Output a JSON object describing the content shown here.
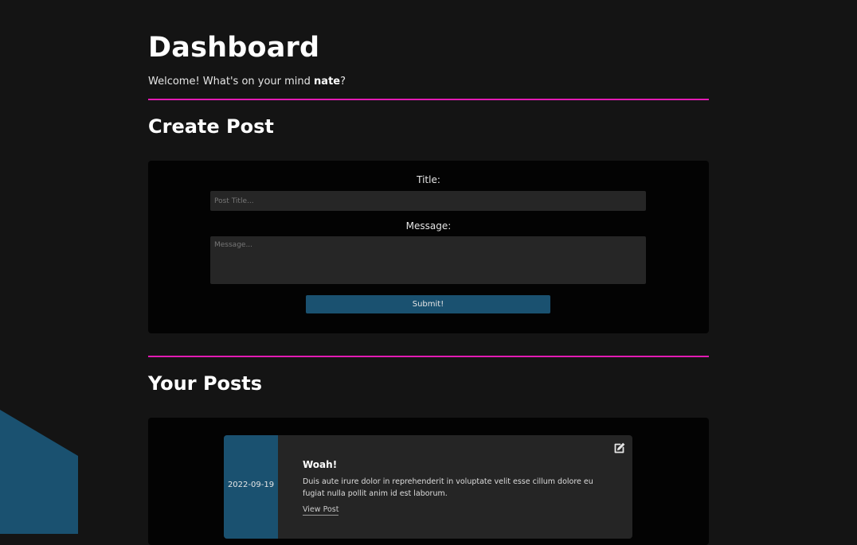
{
  "header": {
    "title": "Dashboard",
    "welcome_prefix": "Welcome! What's on your mind ",
    "username": "nate",
    "welcome_suffix": "?"
  },
  "create_post": {
    "heading": "Create Post",
    "title_label": "Title:",
    "title_placeholder": "Post Title...",
    "title_value": "",
    "message_label": "Message:",
    "message_placeholder": "Message...",
    "message_value": "",
    "submit_label": "Submit!"
  },
  "your_posts": {
    "heading": "Your Posts",
    "posts": [
      {
        "date": "2022-09-19",
        "title": "Woah!",
        "body": "Duis aute irure dolor in reprehenderit in voluptate velit esse cillum dolore eu fugiat nulla pollit anim id est laborum.",
        "link_label": "View Post",
        "edit_icon": "edit-icon"
      }
    ]
  },
  "colors": {
    "background": "#141414",
    "panel": "#030303",
    "accent_divider": "#e21bb3",
    "accent_blue": "#1a5170",
    "input_bg": "#262626",
    "card_bg": "#252525"
  }
}
